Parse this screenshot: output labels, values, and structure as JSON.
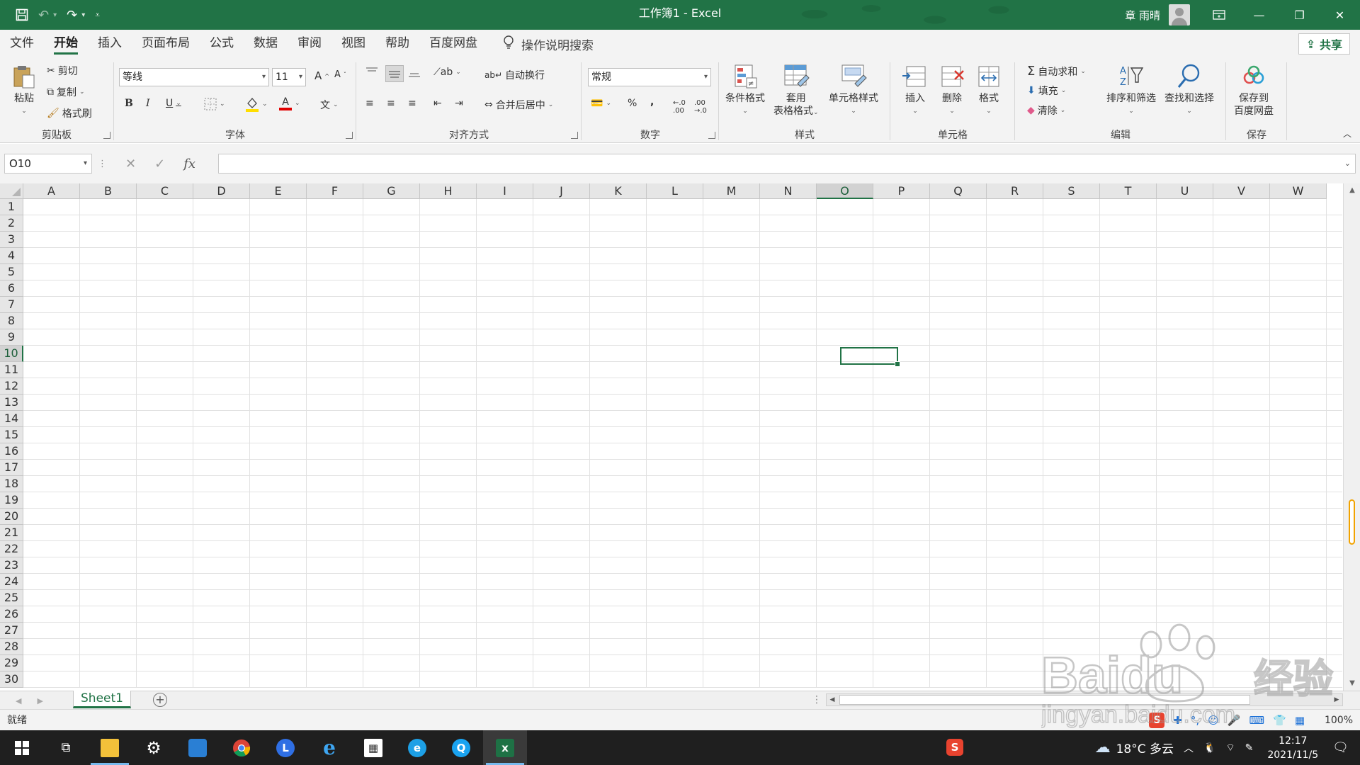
{
  "window": {
    "title": "工作簿1  -  Excel",
    "user_name": "章 雨晴"
  },
  "tabs": [
    "文件",
    "开始",
    "插入",
    "页面布局",
    "公式",
    "数据",
    "审阅",
    "视图",
    "帮助",
    "百度网盘"
  ],
  "active_tab": "开始",
  "tell_me": "操作说明搜索",
  "share_label": "共享",
  "ribbon": {
    "clipboard": {
      "paste": "粘贴",
      "cut": "剪切",
      "copy": "复制",
      "format_painter": "格式刷",
      "label": "剪贴板"
    },
    "font": {
      "font_name": "等线",
      "font_size": "11",
      "grow": "A",
      "shrink": "A",
      "bold": "B",
      "italic": "I",
      "underline": "U",
      "font_color_glyph": "A",
      "phonetic_glyph": "文",
      "label": "字体"
    },
    "alignment": {
      "wrap_text": "自动换行",
      "merge_center": "合并后居中",
      "label": "对齐方式"
    },
    "number": {
      "format": "常规",
      "percent": "%",
      "comma": ",",
      "label": "数字"
    },
    "styles": {
      "conditional": "条件格式",
      "table_line1": "套用",
      "table_line2": "表格格式",
      "cell_styles": "单元格样式",
      "label": "样式"
    },
    "cells": {
      "insert": "插入",
      "delete": "删除",
      "format": "格式",
      "label": "单元格"
    },
    "editing": {
      "sum_glyph": "Σ",
      "autosum": "自动求和",
      "fill": "填充",
      "clear": "清除",
      "sort_filter": "排序和筛选",
      "find_select": "查找和选择",
      "label": "编辑"
    },
    "save": {
      "line1": "保存到",
      "line2": "百度网盘",
      "label": "保存"
    }
  },
  "formula_bar": {
    "name_box": "O10",
    "cancel": "✕",
    "enter": "✓",
    "fx": "fx",
    "value": ""
  },
  "grid": {
    "columns": [
      "A",
      "B",
      "C",
      "D",
      "E",
      "F",
      "G",
      "H",
      "I",
      "J",
      "K",
      "L",
      "M",
      "N",
      "O",
      "P",
      "Q",
      "R",
      "S",
      "T",
      "U",
      "V",
      "W"
    ],
    "rows": [
      "1",
      "2",
      "3",
      "4",
      "5",
      "6",
      "7",
      "8",
      "9",
      "10",
      "11",
      "12",
      "13",
      "14",
      "15",
      "16",
      "17",
      "18",
      "19",
      "20",
      "21",
      "22",
      "23",
      "24",
      "25",
      "26",
      "27",
      "28",
      "29",
      "30"
    ],
    "selected_column": "O",
    "selected_row": "10"
  },
  "sheets": [
    "Sheet1"
  ],
  "active_sheet": "Sheet1",
  "add_sheet": "+",
  "statusbar": {
    "status": "就绪",
    "zoom": "100%"
  },
  "taskbar": {
    "weather": "18°C 多云",
    "time": "12:17",
    "date": "2021/11/5"
  },
  "watermark": {
    "brand": "Baidu",
    "cn": "经验",
    "url": "jingyan.baidu.com"
  },
  "colors": {
    "excel_green": "#217346",
    "taskbar": "#1f1f1f",
    "ribbon_bg": "#f3f3f3"
  }
}
